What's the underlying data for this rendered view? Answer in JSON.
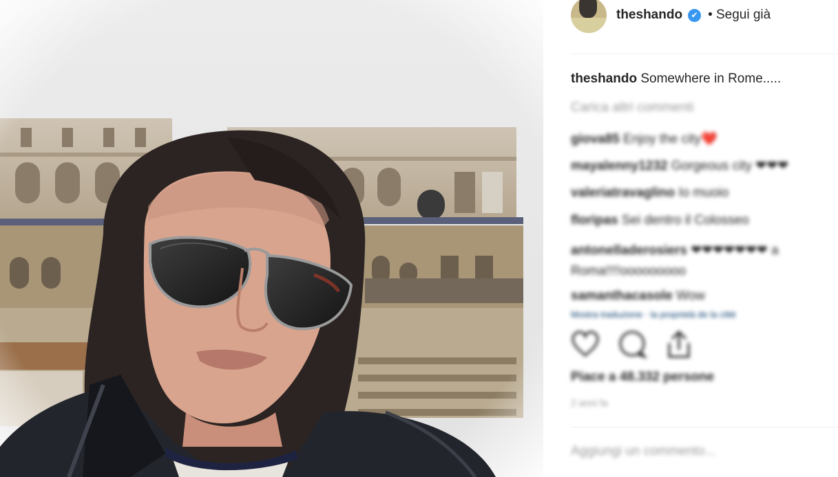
{
  "post": {
    "image_alt": "Selfie at the Colosseum, Rome"
  },
  "header": {
    "username": "theshando",
    "verified_mark": "✔",
    "follow_label": "• Segui già"
  },
  "caption": {
    "username": "theshando",
    "text": "Somewhere in Rome....."
  },
  "comments": {
    "load_more": "Carica altri commenti",
    "items": [
      {
        "username": "giova85",
        "text": "Enjoy the city❤️"
      },
      {
        "username": "mayalenny1232",
        "text": "Gorgeous city ❤❤❤"
      },
      {
        "username": "valeriatravaglino",
        "text": "Io muoio"
      },
      {
        "username": "floripas",
        "text": "Sei dentro il Colosseo"
      },
      {
        "username": "antonelladerosiers",
        "text": "❤❤❤❤❤❤❤ a Roma!!!!ooooooooo"
      },
      {
        "username": "samanthacasole",
        "text": "Wow"
      }
    ],
    "trailing_line": "Mostra traduzione · la proprietà de la cittè"
  },
  "actions": {
    "like_icon": "heart-icon",
    "comment_icon": "comment-bubble-icon",
    "share_icon": "share-icon",
    "likes_text": "Piace a 48.332 persone",
    "time_text": "2 anni fa"
  },
  "add_comment": {
    "placeholder": "Aggiungi un commento..."
  },
  "colors": {
    "verified": "#3897f0",
    "text": "#262626",
    "muted": "#999999"
  }
}
